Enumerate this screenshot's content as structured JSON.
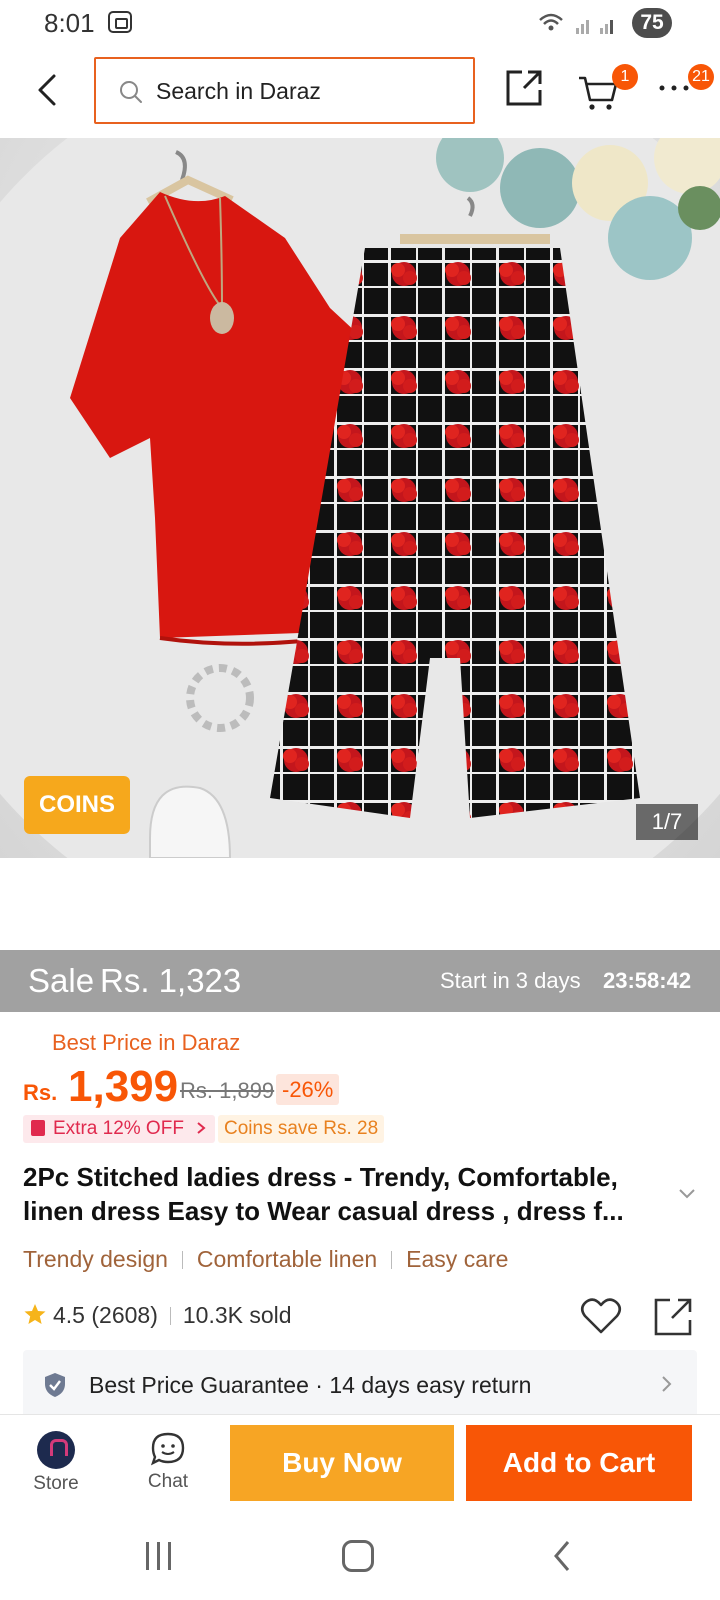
{
  "status_bar": {
    "time": "8:01",
    "battery": "75",
    "icons": [
      "screen-record-icon",
      "wifi-icon",
      "signal-icon",
      "signal-icon"
    ]
  },
  "header": {
    "search_placeholder": "Search in Daraz",
    "cart_count": "1",
    "more_count": "21"
  },
  "gallery": {
    "coins_tag": "COINS",
    "page_indicator": "1/7"
  },
  "sale": {
    "label": "Sale",
    "price": "Rs. 1,323",
    "start_text": "Start in 3 days",
    "countdown": "23:58:42"
  },
  "pricing": {
    "badge": "Best Price in Daraz",
    "currency": "Rs.",
    "price": "1,399",
    "original_price": "Rs. 1,899",
    "discount": "-26%",
    "extra_off": "Extra 12% OFF",
    "coins_save": "Coins save Rs. 28"
  },
  "product": {
    "title": "2Pc Stitched ladies dress - Trendy, Comfortable, linen dress Easy to Wear casual dress , dress f...",
    "features": [
      "Trendy design",
      "Comfortable linen",
      "Easy care"
    ],
    "rating": "4.5",
    "review_count": "(2608)",
    "sold": "10.3K sold"
  },
  "guarantee": {
    "text1": "Best Price Guarantee",
    "separator": "·",
    "text2": "14 days easy return"
  },
  "bottom_bar": {
    "store_label": "Store",
    "chat_label": "Chat",
    "buy_now": "Buy Now",
    "add_to_cart": "Add to Cart"
  },
  "colors": {
    "accent": "#f85606",
    "buy_now": "#f7a524",
    "sale_bar": "#a1a1a1"
  }
}
